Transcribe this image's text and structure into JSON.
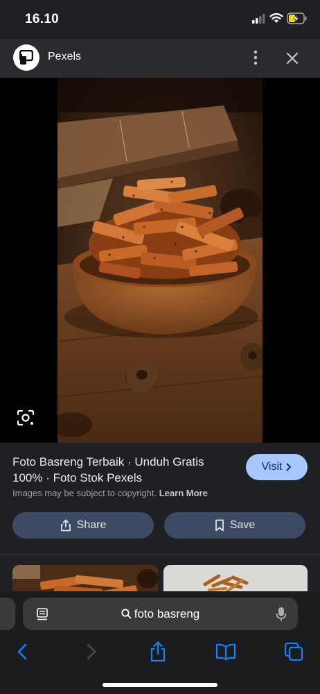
{
  "status": {
    "time": "16.10"
  },
  "header": {
    "site_name": "Pexels"
  },
  "result": {
    "title": "Foto Basreng Terbaik · Unduh Gratis 100% · Foto Stok Pexels",
    "visit_label": "Visit",
    "copyright_text": "Images may be subject to copyright.",
    "learn_more": "Learn More",
    "share_label": "Share",
    "save_label": "Save"
  },
  "browser": {
    "query": "foto basreng"
  },
  "colors": {
    "accent": "#a8c7fa",
    "button_bg": "#3c4b63",
    "link": "#0a84ff"
  },
  "icons": [
    "pexels-logo-icon",
    "more-vert-icon",
    "close-icon",
    "lens-icon",
    "share-icon",
    "bookmark-icon",
    "reader-icon",
    "search-icon",
    "mic-icon",
    "back-icon",
    "forward-icon",
    "share-sheet-icon",
    "bookmarks-icon",
    "tabs-icon"
  ]
}
